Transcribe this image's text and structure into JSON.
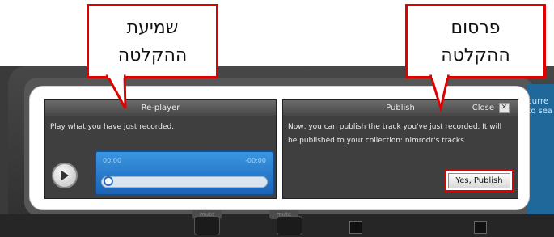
{
  "background": {
    "right_panel_text": "curre\nto sea",
    "mute_label": "mute"
  },
  "callouts": {
    "left": {
      "line1": "שמיעת",
      "line2": "ההקלטה"
    },
    "right": {
      "line1": "פרסום",
      "line2": "ההקלטה"
    }
  },
  "replayer": {
    "title": "Re-player",
    "description": "Play what you have just recorded.",
    "play_icon": "play-icon",
    "time_elapsed": "00:00",
    "time_remaining": "-00:00",
    "progress": 0
  },
  "publish": {
    "title": "Publish",
    "close_label": "Close",
    "close_icon": "x-icon",
    "message": "Now, you can publish the track you've just recorded. It will be published to your collection: nimrodr's tracks",
    "button_label": "Yes, Publish"
  },
  "colors": {
    "callout_border": "#e00000",
    "player_blue": "#2a7fd0",
    "panel_bg": "#3f3f3f"
  }
}
